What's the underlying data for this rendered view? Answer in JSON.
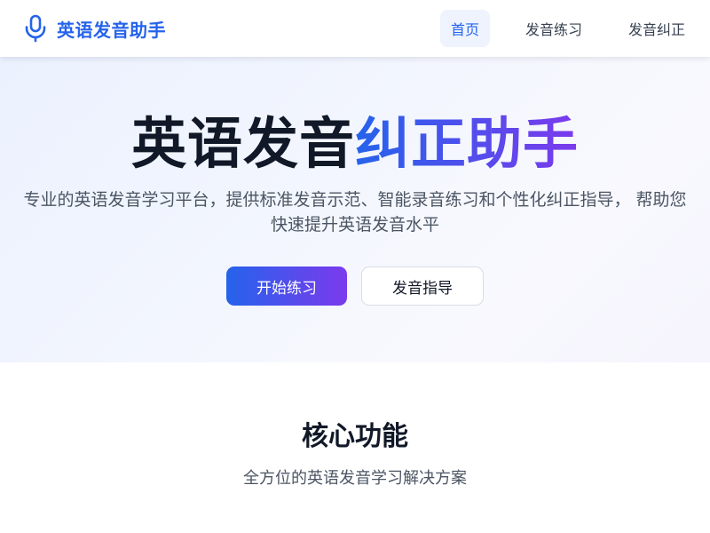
{
  "header": {
    "brand_name": "英语发音助手",
    "brand_icon": "microphone-icon",
    "nav": [
      {
        "label": "首页",
        "active": true
      },
      {
        "label": "发音练习",
        "active": false
      },
      {
        "label": "发音纠正",
        "active": false
      }
    ]
  },
  "hero": {
    "title_plain": "英语发音",
    "title_accent": "纠正助手",
    "subtitle": "专业的英语发音学习平台，提供标准发音示范、智能录音练习和个性化纠正指导， 帮助您快速提升英语发音水平",
    "primary_button": "开始练习",
    "secondary_button": "发音指导"
  },
  "features": {
    "title": "核心功能",
    "subtitle": "全方位的英语发音学习解决方案"
  },
  "colors": {
    "brand": "#2563eb",
    "accent_gradient_start": "#2563eb",
    "accent_gradient_end": "#7c3aed",
    "nav_active_bg": "#eef3fe"
  }
}
